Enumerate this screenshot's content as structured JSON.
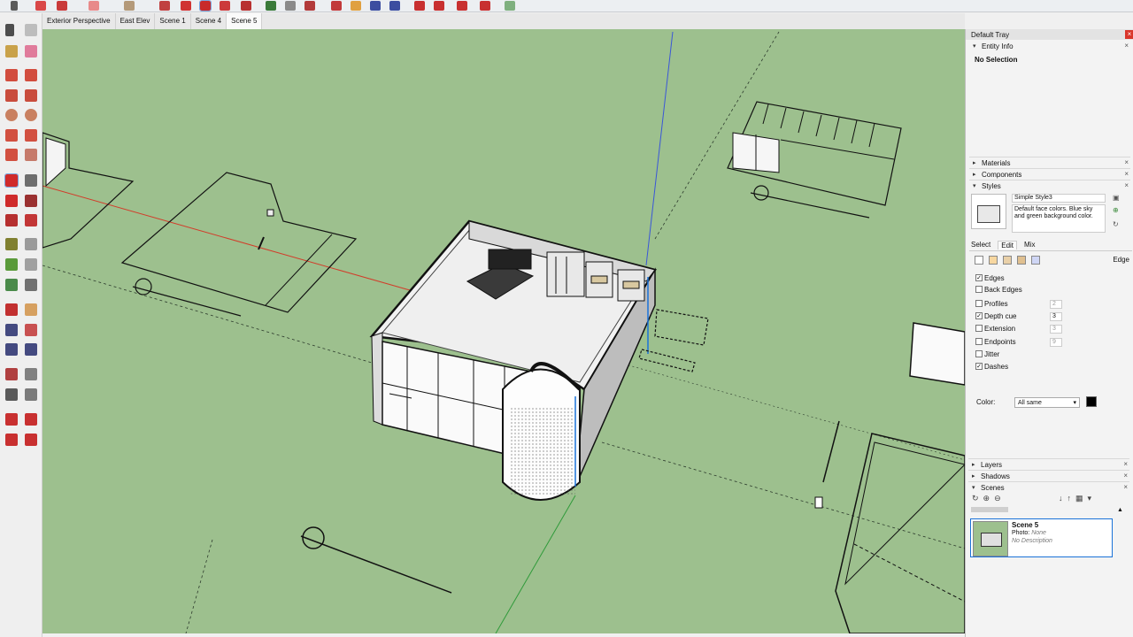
{
  "toolbar": {
    "icons": [
      "select-icon",
      "eraser-icon",
      "paint-icon",
      "pencil-icon",
      "circle-icon",
      "push-pull-icon",
      "move-icon",
      "rotate-icon",
      "scale-icon",
      "offset-icon",
      "orbit-icon",
      "pan-icon",
      "zoom-icon",
      "zoom-extents-icon",
      "section-icon",
      "walk-icon",
      "position-camera-icon",
      "look-around-icon",
      "geo-location-icon"
    ]
  },
  "scene_tabs": [
    "Exterior Perspective",
    "East Elev",
    "Scene 1",
    "Scene 4",
    "Scene 5"
  ],
  "tray": {
    "title": "Default Tray",
    "entity_info": {
      "header": "Entity Info",
      "selection": "No Selection"
    },
    "materials": "Materials",
    "components": "Components",
    "styles": {
      "header": "Styles",
      "style_name": "Simple Style3",
      "style_desc": "Default face colors. Blue sky and green background color.",
      "tabs": [
        "Select",
        "Edit",
        "Mix"
      ],
      "edit_section": "Edge",
      "options": [
        {
          "label": "Edges",
          "checked": "✓",
          "value": ""
        },
        {
          "label": "Back Edges",
          "checked": "",
          "value": ""
        },
        {
          "label": "Profiles",
          "checked": "",
          "value": "2"
        },
        {
          "label": "Depth cue",
          "checked": "✓",
          "value": "3"
        },
        {
          "label": "Extension",
          "checked": "",
          "value": "3"
        },
        {
          "label": "Endpoints",
          "checked": "",
          "value": "9"
        },
        {
          "label": "Jitter",
          "checked": "",
          "value": ""
        },
        {
          "label": "Dashes",
          "checked": "✓",
          "value": ""
        }
      ],
      "color_label": "Color:",
      "color_value": "All same"
    },
    "layers": "Layers",
    "shadows": "Shadows",
    "scenes": {
      "header": "Scenes",
      "item_name": "Scene 5",
      "item_photo_label": "Photo:",
      "item_photo_value": "None",
      "item_desc": "No Description"
    }
  },
  "colors": {
    "viewport_bg": "#9dc08e",
    "selection_blue": "#1a72d8",
    "red_axis": "#d23c2a",
    "green_axis": "#2f9a3a",
    "blue_axis": "#3a56d8"
  }
}
